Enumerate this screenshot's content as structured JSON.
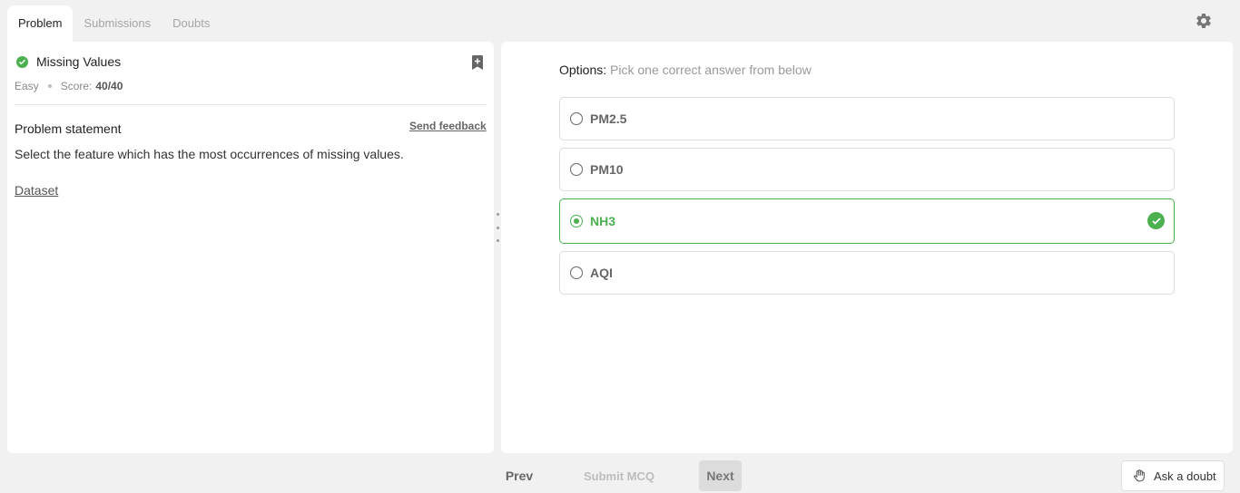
{
  "tabs": [
    {
      "label": "Problem",
      "active": true
    },
    {
      "label": "Submissions",
      "active": false
    },
    {
      "label": "Doubts",
      "active": false
    }
  ],
  "problem": {
    "title": "Missing Values",
    "difficulty": "Easy",
    "score_label": "Score:",
    "score_value": "40/40",
    "statement_heading": "Problem statement",
    "send_feedback": "Send feedback",
    "statement": "Select the feature which has the most occurrences of missing values.",
    "dataset_link": "Dataset"
  },
  "mcq": {
    "options_label": "Options:",
    "options_hint": "Pick one correct answer from below",
    "options": [
      {
        "label": "PM2.5",
        "selected": false,
        "correct": false
      },
      {
        "label": "PM10",
        "selected": false,
        "correct": false
      },
      {
        "label": "NH3",
        "selected": true,
        "correct": true
      },
      {
        "label": "AQI",
        "selected": false,
        "correct": false
      }
    ]
  },
  "footer": {
    "prev": "Prev",
    "submit": "Submit MCQ",
    "next": "Next",
    "ask_doubt": "Ask a doubt"
  },
  "icons": {
    "settings": "gear-icon",
    "bookmark": "bookmark-add-icon",
    "solved": "check-circle-icon",
    "ask": "hand-icon"
  },
  "colors": {
    "accent_green": "#4caf50",
    "background": "#f1f1f1"
  }
}
